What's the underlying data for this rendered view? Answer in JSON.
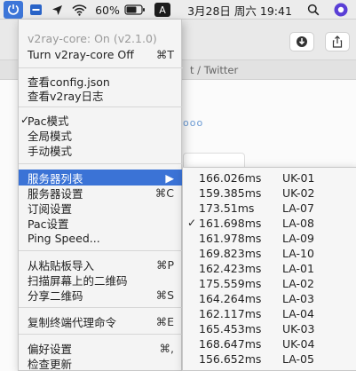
{
  "menubar": {
    "wifi_icon": "wifi-icon",
    "battery": "60%",
    "input_method": "A",
    "datetime": "3月28日 周六 19:41",
    "search_icon": "search-icon"
  },
  "background": {
    "tab_text": "t / Twitter",
    "dots": "ooo"
  },
  "menu": {
    "status": "v2ray-core: On  (v2.1.0)",
    "turn_off": "Turn v2ray-core Off",
    "turn_off_shortcut": "⌘T",
    "view_config": "查看config.json",
    "view_log": "查看v2ray日志",
    "pac_mode": "Pac模式",
    "global_mode": "全局模式",
    "manual_mode": "手动模式",
    "server_list": "服务器列表",
    "server_settings": "服务器设置",
    "server_settings_shortcut": "⌘C",
    "subscription": "订阅设置",
    "pac_settings": "Pac设置",
    "ping_speed": "Ping Speed...",
    "import_clipboard": "从粘贴板导入",
    "import_clipboard_shortcut": "⌘P",
    "scan_qr": "扫描屏幕上的二维码",
    "share_qr": "分享二维码",
    "share_qr_shortcut": "⌘S",
    "copy_proxy": "复制终端代理命令",
    "copy_proxy_shortcut": "⌘E",
    "preferences": "偏好设置",
    "preferences_shortcut": "⌘,",
    "check_update": "检查更新"
  },
  "submenu": {
    "servers": [
      {
        "ms": "166.026ms",
        "loc": "UK-01",
        "checked": false
      },
      {
        "ms": "159.385ms",
        "loc": "UK-02",
        "checked": false
      },
      {
        "ms": "173.51ms",
        "loc": "LA-07",
        "checked": false
      },
      {
        "ms": "161.698ms",
        "loc": "LA-08",
        "checked": true
      },
      {
        "ms": "161.978ms",
        "loc": "LA-09",
        "checked": false
      },
      {
        "ms": "169.823ms",
        "loc": "LA-10",
        "checked": false
      },
      {
        "ms": "162.423ms",
        "loc": "LA-01",
        "checked": false
      },
      {
        "ms": "175.559ms",
        "loc": "LA-02",
        "checked": false
      },
      {
        "ms": "164.264ms",
        "loc": "LA-03",
        "checked": false
      },
      {
        "ms": "162.117ms",
        "loc": "LA-04",
        "checked": false
      },
      {
        "ms": "165.453ms",
        "loc": "UK-03",
        "checked": false
      },
      {
        "ms": "168.647ms",
        "loc": "UK-04",
        "checked": false
      },
      {
        "ms": "156.652ms",
        "loc": "LA-05",
        "checked": false
      }
    ]
  }
}
